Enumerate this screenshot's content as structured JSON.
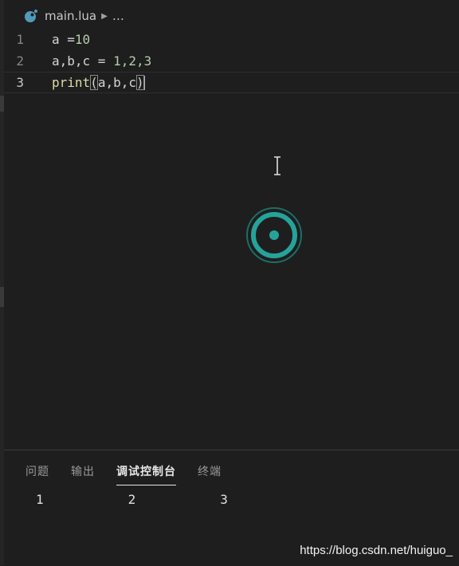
{
  "breadcrumb": {
    "file": "main.lua",
    "ellipsis": "…",
    "file_icon": "lua-file-icon",
    "separator_icon": "chevron-right-icon"
  },
  "editor": {
    "lines": [
      {
        "number": "1",
        "tokens": [
          "a",
          " =",
          "10"
        ]
      },
      {
        "number": "2",
        "tokens": [
          "a,b,c",
          " = ",
          "1,2,3"
        ]
      },
      {
        "number": "3",
        "tokens": [
          "print",
          "(",
          "a,b,c",
          ")"
        ]
      }
    ],
    "current_line": 3
  },
  "overlay": {
    "icon": "recording-indicator-icon",
    "cursor_icon": "text-cursor-icon"
  },
  "panel": {
    "tabs": [
      {
        "label": "问题",
        "active": false
      },
      {
        "label": "输出",
        "active": false
      },
      {
        "label": "调试控制台",
        "active": true
      },
      {
        "label": "终端",
        "active": false
      }
    ],
    "console_output": "1           2           3"
  },
  "watermark": "https://blog.csdn.net/huiguo_"
}
